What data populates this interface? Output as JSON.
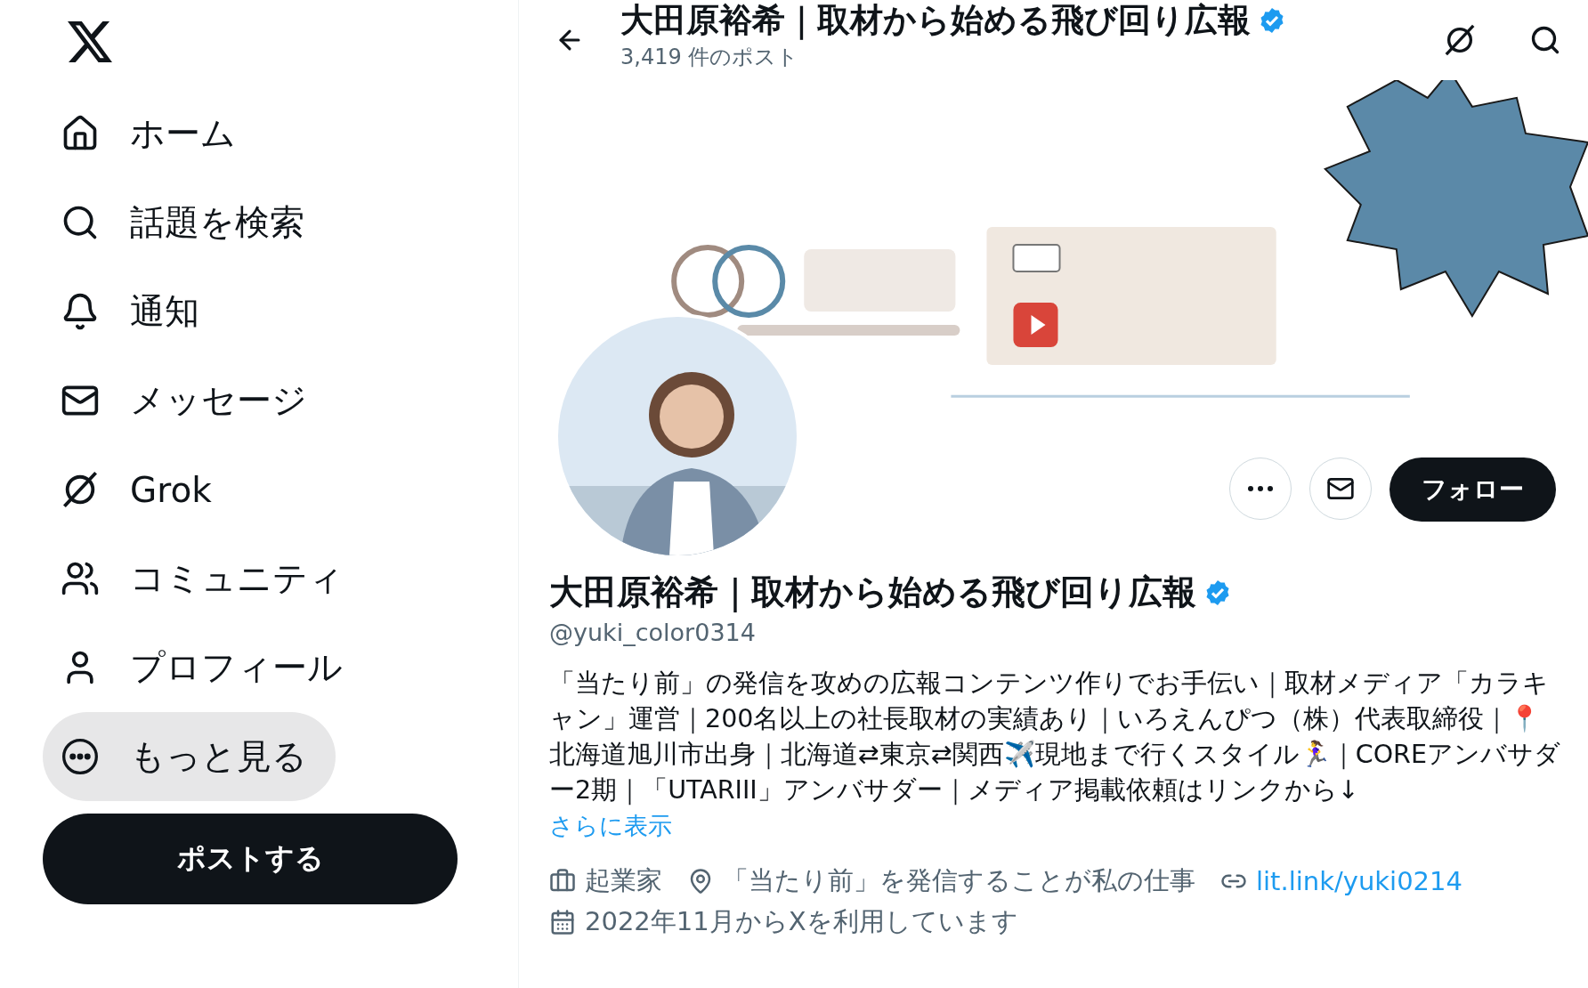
{
  "sidebar": {
    "nav": [
      {
        "kind": "home",
        "label": "ホーム",
        "selected": false
      },
      {
        "kind": "explore",
        "label": "話題を検索",
        "selected": false
      },
      {
        "kind": "notifications",
        "label": "通知",
        "selected": false
      },
      {
        "kind": "messages",
        "label": "メッセージ",
        "selected": false
      },
      {
        "kind": "grok",
        "label": "Grok",
        "selected": false
      },
      {
        "kind": "communities",
        "label": "コミュニティ",
        "selected": false
      },
      {
        "kind": "profile",
        "label": "プロフィール",
        "selected": false
      },
      {
        "kind": "more",
        "label": "もっと見る",
        "selected": true
      }
    ],
    "post_button": "ポストする"
  },
  "header": {
    "title": "大田原裕希｜取材から始める飛び回り広報",
    "verified": true,
    "post_count": "3,419 件のポスト"
  },
  "actions": {
    "follow": "フォロー"
  },
  "profile": {
    "name": "大田原裕希｜取材から始める飛び回り広報",
    "verified": true,
    "handle": "@yuki_color0314",
    "bio": "「当たり前」の発信を攻めの広報コンテンツ作りでお手伝い｜取材メディア「カラキャン」運営｜200名以上の社長取材の実績あり｜いろえんぴつ（株）代表取締役｜📍北海道旭川市出身｜北海道⇄東京⇄関西✈️現地まで行くスタイル🏃‍♀️｜COREアンバサダー2期｜「UTARIII」アンバサダー｜メディア掲載依頼はリンクから↓",
    "show_more": "さらに表示",
    "meta": [
      {
        "kind": "job",
        "text": "起業家"
      },
      {
        "kind": "location",
        "text": "「当たり前」を発信することが私の仕事"
      },
      {
        "kind": "link",
        "text": "lit.link/yuki0214"
      },
      {
        "kind": "joined",
        "text": "2022年11月からXを利用しています"
      }
    ]
  }
}
